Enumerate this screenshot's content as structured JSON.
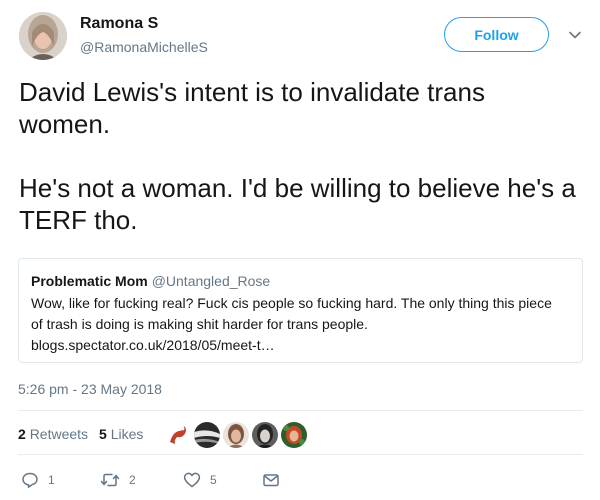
{
  "author": {
    "name": "Ramona S",
    "handle": "@RamonaMichelleS"
  },
  "follow_label": "Follow",
  "tweet": {
    "paragraphs": [
      "David Lewis's intent is to invalidate trans women.",
      "He's not a woman. I'd be willing to believe he's a TERF tho."
    ]
  },
  "quoted_tweet": {
    "name": "Problematic Mom",
    "handle": "@Untangled_Rose",
    "lines": [
      "Wow, like for fucking real? Fuck cis people so fucking hard. The only thing this piece",
      "of trash is doing is making shit harder for trans people.",
      "blogs.spectator.co.uk/2018/05/meet-t…"
    ]
  },
  "timestamp": "5:26 pm - 23 May 2018",
  "stats": {
    "retweets_count": "2",
    "retweets_label": "Retweets",
    "likes_count": "5",
    "likes_label": "Likes"
  },
  "actions": {
    "reply_count": "1",
    "retweet_count": "2",
    "like_count": "5"
  },
  "colors": {
    "accent": "#1da1f2",
    "muted_text": "#657786",
    "primary_text": "#14171a",
    "border": "#e1e8ed"
  },
  "icons": {
    "reply": "speech-bubble-icon",
    "retweet": "retweet-arrows-icon",
    "like": "heart-icon",
    "dm": "envelope-icon",
    "caret": "chevron-down-icon"
  }
}
